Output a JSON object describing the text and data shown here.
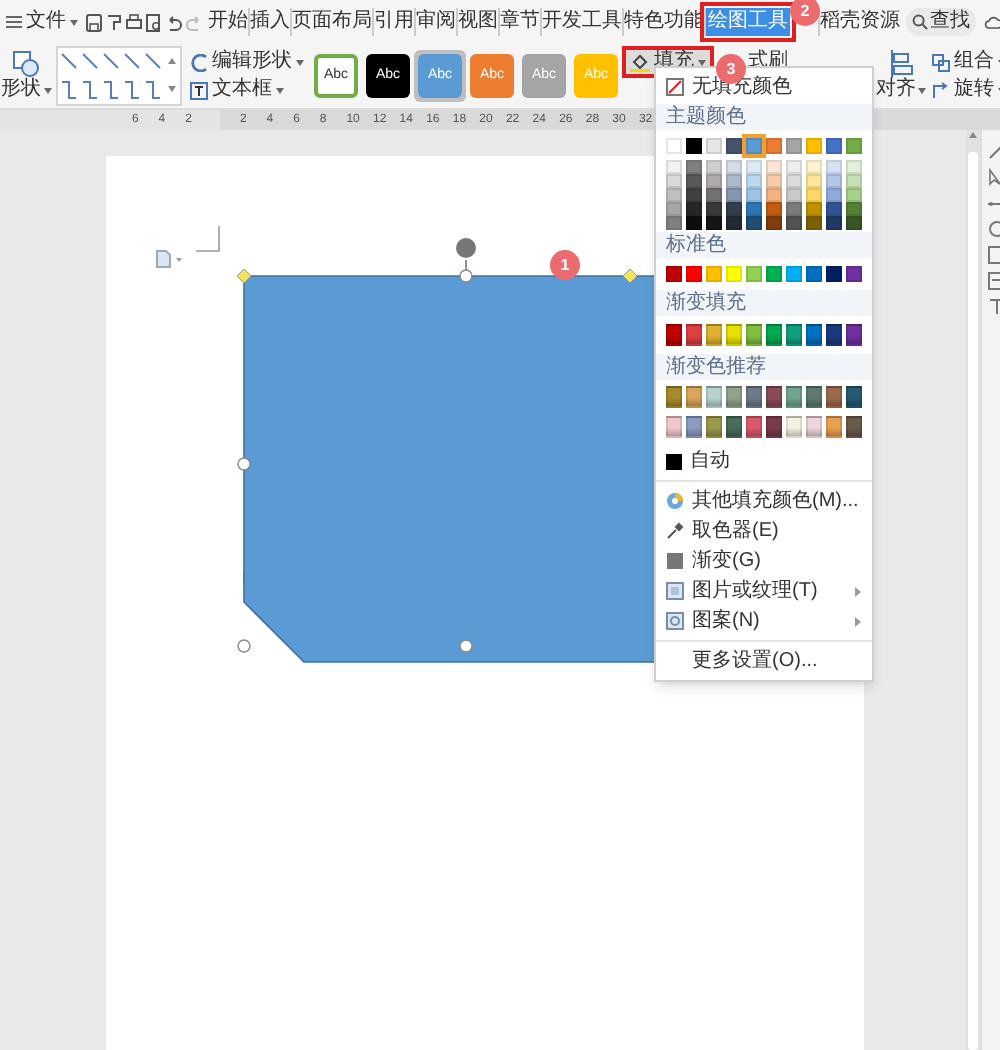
{
  "menu": {
    "label": "文件"
  },
  "tabs": [
    {
      "label": "开始",
      "selected": false
    },
    {
      "label": "插入",
      "selected": false
    },
    {
      "label": "页面布局",
      "selected": false
    },
    {
      "label": "引用",
      "selected": false
    },
    {
      "label": "审阅",
      "selected": false
    },
    {
      "label": "视图",
      "selected": false
    },
    {
      "label": "章节",
      "selected": false
    },
    {
      "label": "开发工具",
      "selected": false
    },
    {
      "label": "特色功能",
      "selected": false
    },
    {
      "label": "绘图工具",
      "selected": true
    },
    {
      "label": "稻壳资源",
      "selected": false
    }
  ],
  "search": {
    "label": "查找"
  },
  "ribbon": {
    "shape_label": "形状",
    "edit_shape": "编辑形状",
    "text_box": "文本框",
    "styles": [
      {
        "label": "Abc",
        "kind": "outline",
        "color": "#70ad47",
        "selected": false
      },
      {
        "label": "Abc",
        "kind": "fill",
        "color": "#000000",
        "selected": false
      },
      {
        "label": "Abc",
        "kind": "fill",
        "color": "#5b9bd5",
        "selected": true
      },
      {
        "label": "Abc",
        "kind": "fill",
        "color": "#ed7d31",
        "selected": false
      },
      {
        "label": "Abc",
        "kind": "fill",
        "color": "#a5a5a5",
        "selected": false
      },
      {
        "label": "Abc",
        "kind": "fill",
        "color": "#ffc000",
        "selected": false
      }
    ],
    "fill": {
      "label": "填充"
    },
    "format_painter": "式刷",
    "align": "对齐",
    "group": "组合",
    "rotate": "旋转"
  },
  "ruler": {
    "left_numbers": [
      "6",
      "4",
      "2"
    ],
    "right_numbers": [
      "2",
      "4",
      "6",
      "8",
      "10",
      "12",
      "14",
      "16",
      "18",
      "20",
      "22",
      "24",
      "26",
      "28",
      "30",
      "32"
    ]
  },
  "annotations": [
    {
      "label": "1"
    },
    {
      "label": "2"
    },
    {
      "label": "3"
    }
  ],
  "fill_menu": {
    "no_fill": "无填充颜色",
    "theme_header": "主题颜色",
    "theme_colors": [
      {
        "color": "#ffffff",
        "selected": false
      },
      {
        "color": "#000000",
        "selected": false
      },
      {
        "color": "#e7e6e6",
        "selected": false
      },
      {
        "color": "#44546a",
        "selected": false
      },
      {
        "color": "#5b9bd5",
        "selected": true
      },
      {
        "color": "#ed7d31",
        "selected": false
      },
      {
        "color": "#a5a5a5",
        "selected": false
      },
      {
        "color": "#ffc000",
        "selected": false
      },
      {
        "color": "#4472c4",
        "selected": false
      },
      {
        "color": "#70ad47",
        "selected": false
      }
    ],
    "theme_shades": [
      [
        {
          "color": "#f2f2f2"
        },
        {
          "color": "#808080"
        },
        {
          "color": "#d0cece"
        },
        {
          "color": "#d6dce4"
        },
        {
          "color": "#deebf6"
        },
        {
          "color": "#fbe5d5"
        },
        {
          "color": "#ededed"
        },
        {
          "color": "#fff2cc"
        },
        {
          "color": "#d9e2f3"
        },
        {
          "color": "#e2efd9"
        }
      ],
      [
        {
          "color": "#d9d9d9"
        },
        {
          "color": "#595959"
        },
        {
          "color": "#aeaaaa"
        },
        {
          "color": "#adb9ca"
        },
        {
          "color": "#bdd7ee"
        },
        {
          "color": "#f7cbac"
        },
        {
          "color": "#dbdbdb"
        },
        {
          "color": "#fee599"
        },
        {
          "color": "#b4c6e7"
        },
        {
          "color": "#c5e0b3"
        }
      ],
      [
        {
          "color": "#bfbfbf"
        },
        {
          "color": "#404040"
        },
        {
          "color": "#757171"
        },
        {
          "color": "#8496b0"
        },
        {
          "color": "#9dc3e6"
        },
        {
          "color": "#f4b183"
        },
        {
          "color": "#c9c9c9"
        },
        {
          "color": "#ffd965"
        },
        {
          "color": "#8eaadb"
        },
        {
          "color": "#a8d08d"
        }
      ],
      [
        {
          "color": "#a6a6a6"
        },
        {
          "color": "#262626"
        },
        {
          "color": "#3a3838"
        },
        {
          "color": "#333f4f"
        },
        {
          "color": "#2e75b5"
        },
        {
          "color": "#c55a11"
        },
        {
          "color": "#7b7b7b"
        },
        {
          "color": "#bf9000"
        },
        {
          "color": "#2f5496"
        },
        {
          "color": "#538135"
        }
      ],
      [
        {
          "color": "#808080"
        },
        {
          "color": "#0d0d0d"
        },
        {
          "color": "#171616"
        },
        {
          "color": "#222a35"
        },
        {
          "color": "#1f4e79"
        },
        {
          "color": "#833c0b"
        },
        {
          "color": "#525252"
        },
        {
          "color": "#7f6000"
        },
        {
          "color": "#1f3864"
        },
        {
          "color": "#375623"
        }
      ]
    ],
    "standard_header": "标准色",
    "standard_colors": [
      {
        "color": "#c00000"
      },
      {
        "color": "#ff0000"
      },
      {
        "color": "#ffc000"
      },
      {
        "color": "#ffff00"
      },
      {
        "color": "#92d050"
      },
      {
        "color": "#00b050"
      },
      {
        "color": "#00b0f0"
      },
      {
        "color": "#0070c0"
      },
      {
        "color": "#002060"
      },
      {
        "color": "#7030a0"
      }
    ],
    "gradient_header": "渐变填充",
    "gradient_colors": [
      {
        "color": "#c00000"
      },
      {
        "color": "#e04040"
      },
      {
        "color": "#e0b030"
      },
      {
        "color": "#e8e000"
      },
      {
        "color": "#80c040"
      },
      {
        "color": "#00a850"
      },
      {
        "color": "#10a080"
      },
      {
        "color": "#0070c0"
      },
      {
        "color": "#1a3a80"
      },
      {
        "color": "#7030a0"
      }
    ],
    "recommend_header": "渐变色推荐",
    "recommend_rows": [
      [
        {
          "color": "#a68a2b"
        },
        {
          "color": "#d9a55a"
        },
        {
          "color": "#b7d3d0"
        },
        {
          "color": "#8fa38c"
        },
        {
          "color": "#6c7a8c"
        },
        {
          "color": "#8c4a57"
        },
        {
          "color": "#6fa58c"
        },
        {
          "color": "#5d7a73"
        },
        {
          "color": "#9a6a4a"
        },
        {
          "color": "#245a73"
        }
      ],
      [
        {
          "color": "#f0c8cc"
        },
        {
          "color": "#8c9cc0"
        },
        {
          "color": "#9a9a4a"
        },
        {
          "color": "#4a6a5a"
        },
        {
          "color": "#d95a6a"
        },
        {
          "color": "#7a3a4a"
        },
        {
          "color": "#f5f0e0"
        },
        {
          "color": "#ecd6dc"
        },
        {
          "color": "#e8a050"
        },
        {
          "color": "#6a5a4a"
        }
      ]
    ],
    "auto": {
      "label": "自动",
      "color": "#000000"
    },
    "items": [
      {
        "label": "其他填充颜色(M)...",
        "kind": "palette",
        "submenu": false
      },
      {
        "label": "取色器(E)",
        "kind": "eyedropper",
        "submenu": false
      },
      {
        "label": "渐变(G)",
        "kind": "gradient",
        "submenu": false
      },
      {
        "label": "图片或纹理(T)",
        "kind": "picture",
        "submenu": true
      },
      {
        "label": "图案(N)",
        "kind": "pattern",
        "submenu": true
      },
      {
        "label": "更多设置(O)...",
        "kind": "plain",
        "submenu": false
      }
    ]
  }
}
